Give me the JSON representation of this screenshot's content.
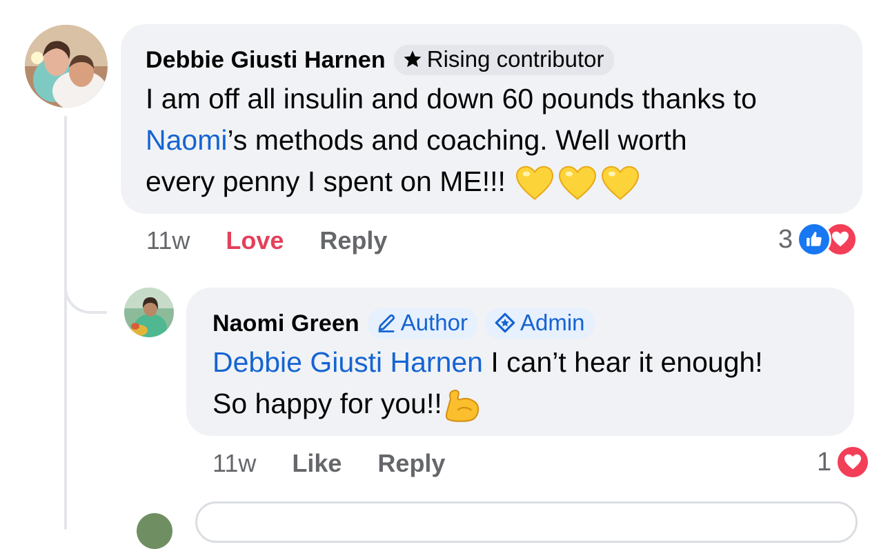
{
  "comments": [
    {
      "author": "Debbie Giusti Harnen",
      "badges": [
        {
          "label": "Rising contributor",
          "icon": "star-icon"
        }
      ],
      "text_lines": [
        "I am off all insulin and down 60 pounds thanks to",
        {
          "mention": "Naomi",
          "rest": "’s methods and coaching.  Well worth"
        },
        "every penny I spent on ME!!!"
      ],
      "emojis": [
        "yellow-heart",
        "yellow-heart",
        "yellow-heart"
      ],
      "time": "11w",
      "actions": [
        "Love",
        "Reply"
      ],
      "reaction_count": "3",
      "reactions": [
        "like-icon",
        "love-icon"
      ]
    },
    {
      "author": "Naomi Green",
      "badges": [
        {
          "label": "Author",
          "icon": "pencil-icon"
        },
        {
          "label": "Admin",
          "icon": "shield-diamond-icon"
        }
      ],
      "mention": "Debbie Giusti Harnen",
      "text_line1_rest": " I can’t hear it enough!",
      "text_line2": "So happy for you!!",
      "emojis": [
        "flexed-biceps"
      ],
      "time": "11w",
      "actions": [
        "Like",
        "Reply"
      ],
      "reaction_count": "1",
      "reactions": [
        "love-icon"
      ]
    }
  ],
  "colors": {
    "bubble": "#f0f2f5",
    "link": "#1464d2",
    "love": "#e4405a",
    "meta": "#65676b",
    "like_reaction": "#1877f2",
    "love_reaction": "#f33e58"
  }
}
